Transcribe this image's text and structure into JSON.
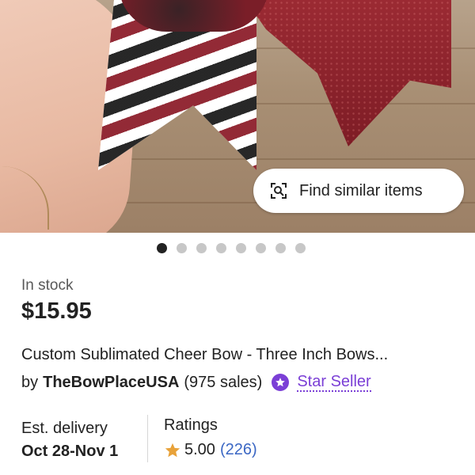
{
  "photo": {
    "alt_subject": ""
  },
  "find_similar": {
    "label": "Find similar items",
    "icon": "image-search-icon"
  },
  "carousel": {
    "count": 8,
    "active_index": 0
  },
  "product": {
    "stock": "In stock",
    "price": "$15.95",
    "title": "Custom Sublimated Cheer Bow - Three Inch Bows...",
    "by": "by",
    "seller": "TheBowPlaceUSA",
    "sales": "(975 sales)",
    "star_seller": "Star Seller",
    "star_seller_color": "#7b3fd6"
  },
  "delivery": {
    "label": "Est. delivery",
    "value": "Oct 28-Nov 1"
  },
  "ratings": {
    "label": "Ratings",
    "score": "5.00",
    "count": "(226)",
    "star_color": "#e8a23a",
    "count_color": "#3b67c4"
  }
}
